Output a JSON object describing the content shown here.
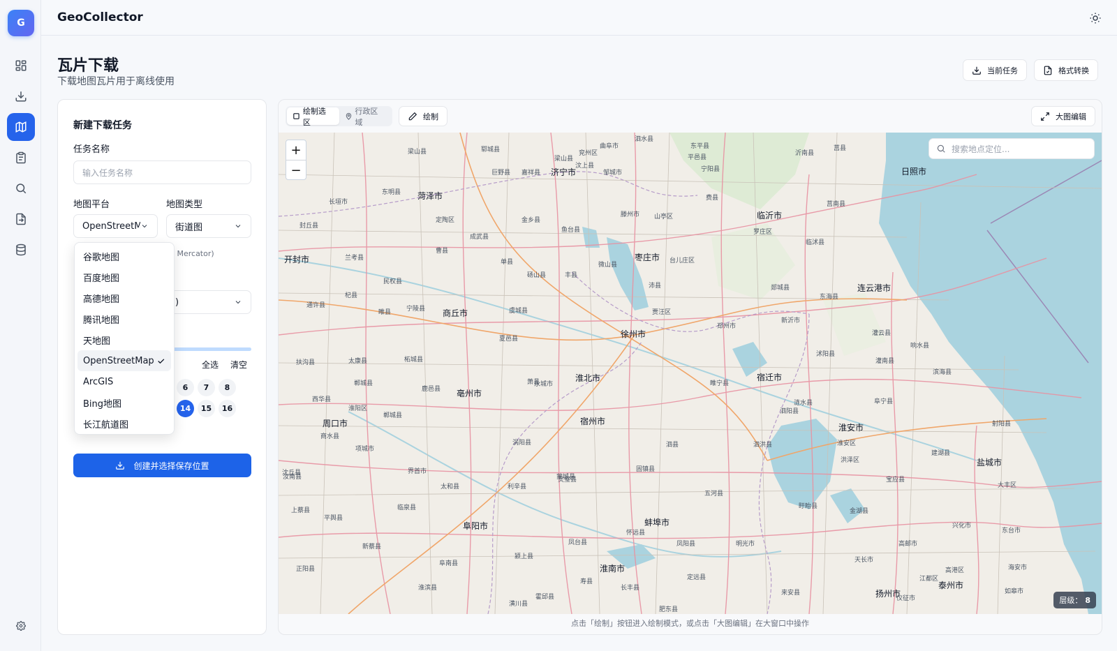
{
  "sidebar": {
    "logo_letter": "G",
    "items": [
      {
        "icon": "grid-icon"
      },
      {
        "icon": "download-icon"
      },
      {
        "icon": "map-icon",
        "active": true
      },
      {
        "icon": "clipboard-icon"
      },
      {
        "icon": "search-icon"
      },
      {
        "icon": "file-convert-icon"
      },
      {
        "icon": "database-icon"
      }
    ],
    "footer_icon": "settings-icon"
  },
  "topbar": {
    "app_title": "GeoCollector",
    "theme_icon": "sun-icon"
  },
  "header": {
    "title": "瓦片下载",
    "subtitle": "下载地图瓦片用于离线使用",
    "buttons": {
      "current_task": "当前任务",
      "format_convert": "格式转换"
    }
  },
  "form": {
    "panel_title": "新建下载任务",
    "task_name_label": "任务名称",
    "task_name_placeholder": "输入任务名称",
    "platform_label": "地图平台",
    "platform_value": "OpenStreetMap",
    "map_type_label": "地图类型",
    "map_type_value": "街道图",
    "projection_hint_fragment": "b Mercator)",
    "third_select_fragment": ")",
    "select_all": "全选",
    "clear": "清空",
    "levels_row1": [
      "6",
      "7",
      "8"
    ],
    "levels_row2": [
      "14",
      "15",
      "16"
    ],
    "selected_level": "14",
    "create_button": "创建并选择保存位置"
  },
  "platform_dropdown": {
    "options": [
      "谷歌地图",
      "百度地图",
      "高德地图",
      "腾讯地图",
      "天地图",
      "OpenStreetMap",
      "ArcGIS",
      "Bing地图",
      "长江航道图"
    ],
    "selected": "OpenStreetMap"
  },
  "map_toolbar": {
    "tab_draw_select": "绘制选区",
    "tab_admin_area": "行政区域",
    "draw_button": "绘制",
    "fullscreen_button": "大图编辑",
    "search_placeholder": "搜索地点定位...",
    "zoom_in": "+",
    "zoom_out": "−",
    "level_label": "层级：",
    "level_value": "8",
    "footer_hint": "点击「绘制」按钮进入绘制模式，或点击「大图编辑」在大窗口中操作"
  },
  "map_labels": [
    {
      "name": "济宁市",
      "kind": "big"
    },
    {
      "name": "菏泽市",
      "kind": "big"
    },
    {
      "name": "临沂市",
      "kind": "big"
    },
    {
      "name": "日照市",
      "kind": "big"
    },
    {
      "name": "枣庄市",
      "kind": "big"
    },
    {
      "name": "开封市",
      "kind": "big"
    },
    {
      "name": "商丘市",
      "kind": "big"
    },
    {
      "name": "徐州市",
      "kind": "big"
    },
    {
      "name": "连云港市",
      "kind": "big"
    },
    {
      "name": "宿迁市",
      "kind": "big"
    },
    {
      "name": "淮北市",
      "kind": "big"
    },
    {
      "name": "亳州市",
      "kind": "big"
    },
    {
      "name": "宿州市",
      "kind": "big"
    },
    {
      "name": "周口市",
      "kind": "big"
    },
    {
      "name": "淮安市",
      "kind": "big"
    },
    {
      "name": "盐城市",
      "kind": "big"
    },
    {
      "name": "阜阳市",
      "kind": "big"
    },
    {
      "name": "蚌埠市",
      "kind": "big"
    },
    {
      "name": "淮南市",
      "kind": "big"
    },
    {
      "name": "扬州市",
      "kind": "big"
    },
    {
      "name": "泰州市",
      "kind": "big"
    },
    {
      "name": "泗水县",
      "kind": "town"
    },
    {
      "name": "曲阜市",
      "kind": "town"
    },
    {
      "name": "兖州区",
      "kind": "town"
    },
    {
      "name": "邹城市",
      "kind": "town"
    },
    {
      "name": "嘉祥县",
      "kind": "town"
    },
    {
      "name": "巨野县",
      "kind": "town"
    },
    {
      "name": "郓城县",
      "kind": "town"
    },
    {
      "name": "梁山县",
      "kind": "town"
    },
    {
      "name": "平邑县",
      "kind": "town"
    },
    {
      "name": "沂南县",
      "kind": "town"
    },
    {
      "name": "莒县",
      "kind": "town"
    },
    {
      "name": "东明县",
      "kind": "town"
    },
    {
      "name": "长垣市",
      "kind": "town"
    },
    {
      "name": "封丘县",
      "kind": "town"
    },
    {
      "name": "定陶区",
      "kind": "town"
    },
    {
      "name": "金乡县",
      "kind": "town"
    },
    {
      "name": "鱼台县",
      "kind": "town"
    },
    {
      "name": "滕州市",
      "kind": "town"
    },
    {
      "name": "山亭区",
      "kind": "town"
    },
    {
      "name": "费县",
      "kind": "town"
    },
    {
      "name": "罗庄区",
      "kind": "town"
    },
    {
      "name": "莒南县",
      "kind": "town"
    },
    {
      "name": "临沭县",
      "kind": "town"
    },
    {
      "name": "成武县",
      "kind": "town"
    },
    {
      "name": "单县",
      "kind": "town"
    },
    {
      "name": "曹县",
      "kind": "town"
    },
    {
      "name": "兰考县",
      "kind": "town"
    },
    {
      "name": "民权县",
      "kind": "town"
    },
    {
      "name": "杞县",
      "kind": "town"
    },
    {
      "name": "通许县",
      "kind": "town"
    },
    {
      "name": "睢县",
      "kind": "town"
    },
    {
      "name": "宁陵县",
      "kind": "town"
    },
    {
      "name": "虞城县",
      "kind": "town"
    },
    {
      "name": "砀山县",
      "kind": "town"
    },
    {
      "name": "丰县",
      "kind": "town"
    },
    {
      "name": "沛县",
      "kind": "town"
    },
    {
      "name": "微山县",
      "kind": "town"
    },
    {
      "name": "台儿庄区",
      "kind": "town"
    },
    {
      "name": "贾汪区",
      "kind": "town"
    },
    {
      "name": "邳州市",
      "kind": "town"
    },
    {
      "name": "郯城县",
      "kind": "town"
    },
    {
      "name": "东海县",
      "kind": "town"
    },
    {
      "name": "灌云县",
      "kind": "town"
    },
    {
      "name": "新沂市",
      "kind": "town"
    },
    {
      "name": "睢宁县",
      "kind": "town"
    },
    {
      "name": "沭阳县",
      "kind": "town"
    },
    {
      "name": "灌南县",
      "kind": "town"
    },
    {
      "name": "响水县",
      "kind": "town"
    },
    {
      "name": "滨海县",
      "kind": "town"
    },
    {
      "name": "阜宁县",
      "kind": "town"
    },
    {
      "name": "射阳县",
      "kind": "town"
    },
    {
      "name": "涟水县",
      "kind": "town"
    },
    {
      "name": "泗阳县",
      "kind": "town"
    },
    {
      "name": "泗洪县",
      "kind": "town"
    },
    {
      "name": "盱眙县",
      "kind": "town"
    },
    {
      "name": "金湖县",
      "kind": "town"
    },
    {
      "name": "宝应县",
      "kind": "town"
    },
    {
      "name": "建湖县",
      "kind": "town"
    },
    {
      "name": "大丰区",
      "kind": "town"
    },
    {
      "name": "兴化市",
      "kind": "town"
    },
    {
      "name": "东台市",
      "kind": "town"
    },
    {
      "name": "高邮市",
      "kind": "town"
    },
    {
      "name": "天长市",
      "kind": "town"
    },
    {
      "name": "来安县",
      "kind": "town"
    },
    {
      "name": "明光市",
      "kind": "town"
    },
    {
      "name": "定远县",
      "kind": "town"
    },
    {
      "name": "凤阳县",
      "kind": "town"
    },
    {
      "name": "五河县",
      "kind": "town"
    },
    {
      "name": "固镇县",
      "kind": "town"
    },
    {
      "name": "灵璧县",
      "kind": "town"
    },
    {
      "name": "泗县",
      "kind": "town"
    },
    {
      "name": "萧县",
      "kind": "town"
    },
    {
      "name": "永城市",
      "kind": "town"
    },
    {
      "name": "夏邑县",
      "kind": "town"
    },
    {
      "name": "柘城县",
      "kind": "town"
    },
    {
      "name": "鹿邑县",
      "kind": "town"
    },
    {
      "name": "郸城县",
      "kind": "town"
    },
    {
      "name": "淮阳区",
      "kind": "town"
    },
    {
      "name": "太康县",
      "kind": "town"
    },
    {
      "name": "扶沟县",
      "kind": "town"
    },
    {
      "name": "西华县",
      "kind": "town"
    },
    {
      "name": "项城市",
      "kind": "town"
    },
    {
      "name": "沈丘县",
      "kind": "town"
    },
    {
      "name": "界首市",
      "kind": "town"
    },
    {
      "name": "太和县",
      "kind": "town"
    },
    {
      "name": "临泉县",
      "kind": "town"
    },
    {
      "name": "涡阳县",
      "kind": "town"
    },
    {
      "name": "利辛县",
      "kind": "town"
    },
    {
      "name": "蒙城县",
      "kind": "town"
    },
    {
      "name": "怀远县",
      "kind": "town"
    },
    {
      "name": "凤台县",
      "kind": "town"
    },
    {
      "name": "颍上县",
      "kind": "town"
    },
    {
      "name": "阜南县",
      "kind": "town"
    },
    {
      "name": "淮滨县",
      "kind": "town"
    },
    {
      "name": "寿县",
      "kind": "town"
    },
    {
      "name": "长丰县",
      "kind": "town"
    },
    {
      "name": "霍邱县",
      "kind": "town"
    },
    {
      "name": "潢川县",
      "kind": "town"
    },
    {
      "name": "正阳县",
      "kind": "town"
    },
    {
      "name": "平舆县",
      "kind": "town"
    },
    {
      "name": "新蔡县",
      "kind": "town"
    },
    {
      "name": "上蔡县",
      "kind": "town"
    },
    {
      "name": "汝南县",
      "kind": "town"
    },
    {
      "name": "商水县",
      "kind": "town"
    },
    {
      "name": "郸城县",
      "kind": "town"
    },
    {
      "name": "宁阳县",
      "kind": "town"
    },
    {
      "name": "洪泽区",
      "kind": "town"
    },
    {
      "name": "淮安区",
      "kind": "town"
    },
    {
      "name": "海安市",
      "kind": "town"
    },
    {
      "name": "如皋市",
      "kind": "town"
    },
    {
      "name": "高港区",
      "kind": "town"
    },
    {
      "name": "江都区",
      "kind": "town"
    },
    {
      "name": "仪征市",
      "kind": "town"
    },
    {
      "name": "肥东县",
      "kind": "town"
    },
    {
      "name": "东平县",
      "kind": "town"
    },
    {
      "name": "汶上县",
      "kind": "town"
    },
    {
      "name": "梁山县",
      "kind": "town"
    }
  ]
}
